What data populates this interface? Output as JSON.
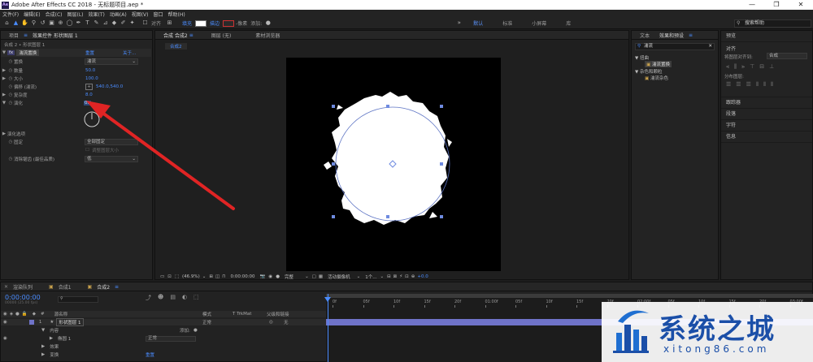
{
  "window": {
    "title": "Adobe After Effects CC 2018 - 无标题项目.aep *",
    "logo": "Ae"
  },
  "menu": [
    "文件(F)",
    "编辑(E)",
    "合成(C)",
    "图层(L)",
    "效果(T)",
    "动画(A)",
    "视图(V)",
    "窗口",
    "帮助(H)"
  ],
  "toolbar": {
    "snap_label": "对齐",
    "fill_label": "填充",
    "stroke_label": "描边",
    "stroke_px": "-像素",
    "add_label": "添加:",
    "workspaces": [
      "默认",
      "标准",
      "小屏幕",
      "库"
    ],
    "active_workspace": "默认",
    "search_placeholder": "搜索帮助"
  },
  "effect_controls": {
    "tabs": [
      "项目",
      "效果控件 形状图层 1"
    ],
    "subtitle": "合成 2 • 形状图层 1",
    "effect_name": "湍流置换",
    "reset": "重置",
    "about": "关于...",
    "rows": [
      {
        "label": "置换",
        "value": "湍流"
      },
      {
        "label": "数量",
        "value": "50.0"
      },
      {
        "label": "大小",
        "value": "100.0"
      },
      {
        "label": "偏移 (湍流)",
        "value": "540.0,540.0"
      },
      {
        "label": "复杂度",
        "value": "8.0"
      },
      {
        "label": "演化",
        "value": "0x"
      }
    ],
    "evolution_options": "演化选项",
    "pinning_label": "固定",
    "pinning_value": "全部固定",
    "resize_label": "调整图层大小",
    "antialias_label": "消除锯齿 (最佳品质)",
    "antialias_value": "低"
  },
  "composition": {
    "panel_tabs": [
      "合成 合成2",
      "图层 (无)",
      "素材浏览器"
    ],
    "breadcrumb": "合成2",
    "zoom": "(46.9%)",
    "timecode": "0:00:00:00",
    "quality": "完整",
    "camera": "活动摄像机",
    "views": "1个...",
    "exposure": "+0.0"
  },
  "effects_presets": {
    "tabs": [
      "文本",
      "效果和预设"
    ],
    "search_value": "湍流",
    "groups": [
      {
        "name": "扭曲",
        "items": [
          "湍流置换"
        ]
      },
      {
        "name": "杂色和颗粒",
        "items": [
          "湍流杂色"
        ]
      }
    ]
  },
  "align_panel": {
    "tabs": [
      "预览",
      "对齐"
    ],
    "align_to_label": "将图层对齐到:",
    "align_to_value": "合成",
    "distribute_label": "分布图层:",
    "panels": [
      "跟踪器",
      "段落",
      "字符",
      "信息"
    ]
  },
  "timeline": {
    "tabs": [
      "渲染队列",
      "合成1",
      "合成2"
    ],
    "timecode": "0:00:00:00",
    "fps_info": "00000 (25.00 fps)",
    "columns": [
      "源名称",
      "模式",
      "T TrkMat",
      "父级和链接"
    ],
    "layer_index": "1",
    "layer_name": "形状图层 1",
    "layer_mode": "正常",
    "layer_parent": "无",
    "sub_rows": [
      {
        "label": "内容",
        "extra": "添加:"
      },
      {
        "label": "椭圆 1",
        "extra": "正常"
      },
      {
        "label": "效果",
        "extra": ""
      },
      {
        "label": "变换",
        "extra": "重置"
      }
    ],
    "ruler": [
      "0f",
      "05f",
      "10f",
      "15f",
      "20f",
      "01:00f",
      "05f",
      "10f",
      "15f",
      "20f",
      "02:00f",
      "05f",
      "10f",
      "15f",
      "20f",
      "03:00f"
    ]
  },
  "watermark": {
    "brand": "系统之城",
    "url": "xitong86.com"
  },
  "colors": {
    "accent": "#4a8cff",
    "layer_bar": "#6f73c8",
    "arrow": "#e02424"
  }
}
